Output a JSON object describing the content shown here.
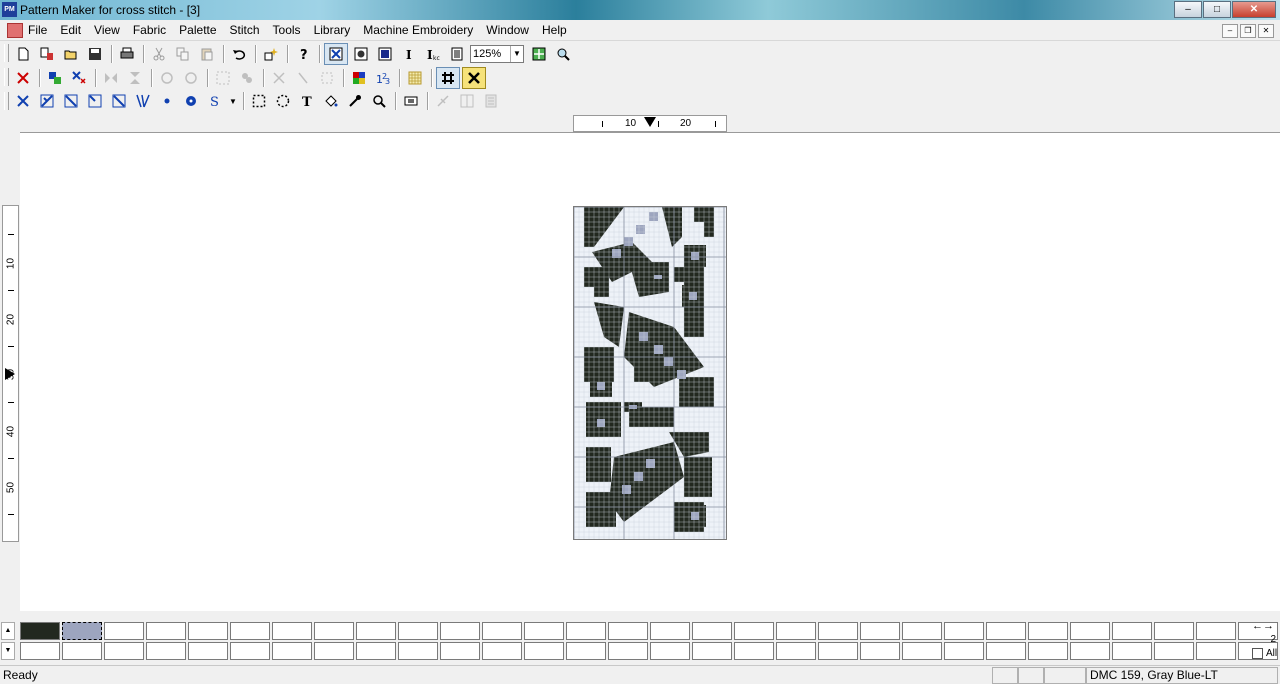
{
  "window": {
    "title": "Pattern Maker for cross stitch - [3]",
    "icon_label": "PM"
  },
  "menu": [
    "File",
    "Edit",
    "View",
    "Fabric",
    "Palette",
    "Stitch",
    "Tools",
    "Library",
    "Machine Embroidery",
    "Window",
    "Help"
  ],
  "toolbar": {
    "zoom": "125%"
  },
  "rulers": {
    "horizontal_labels": [
      "10",
      "20"
    ],
    "vertical_labels": [
      "10",
      "20",
      "30",
      "40",
      "50"
    ]
  },
  "colors": {
    "floss_dark": "#22281f",
    "floss_gray_blue": "#9da5bf",
    "grid_background": "#eef2f8"
  },
  "palette": {
    "count": "2",
    "all_label": "All"
  },
  "status": {
    "ready": "Ready",
    "thread": "DMC 159, Gray Blue-LT"
  }
}
